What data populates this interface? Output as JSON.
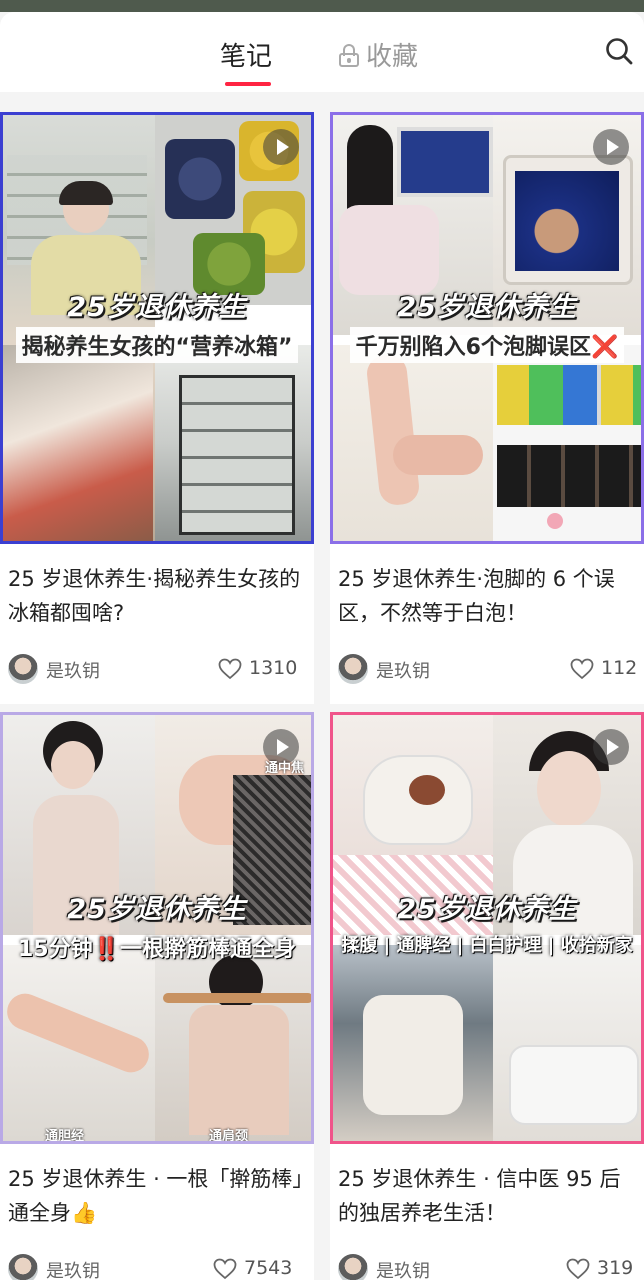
{
  "header": {
    "tab_notes": "笔记",
    "tab_favorites": "收藏"
  },
  "cards": [
    {
      "overlay_title": "25岁退休养生",
      "overlay_sub": "揭秘养生女孩的“营养冰箱”",
      "title": "25 岁退休养生·揭秘养生女孩的冰箱都囤啥?",
      "author": "是玖钥",
      "likes": "1310",
      "border_color": "#3b3fd1"
    },
    {
      "overlay_title": "25岁退休养生",
      "overlay_sub": "千万别陷入6个泡脚误区❌",
      "title": "25 岁退休养生·泡脚的 6 个误区，不然等于白泡！",
      "author": "是玖钥",
      "likes": "112",
      "border_color": "#8b6fe8"
    },
    {
      "overlay_title": "25岁退休养生",
      "overlay_sub": "15分钟‼️一根擀筋棒通全身",
      "title": "25 岁退休养生 · 一根「擀筋棒」通全身👍",
      "author": "是玖钥",
      "likes": "7543",
      "border_color": "#b9a9e6",
      "tags": [
        "通中焦",
        "通胆经",
        "通肩颈"
      ]
    },
    {
      "overlay_title": "25岁退休养生",
      "overlay_sub": "揉腹 | 通脾经 | 白白护理 | 收拾新家",
      "title": "25 岁退休养生 · 信中医 95 后的独居养老生活！",
      "author": "是玖钥",
      "likes": "319",
      "border_color": "#f0548a"
    }
  ]
}
